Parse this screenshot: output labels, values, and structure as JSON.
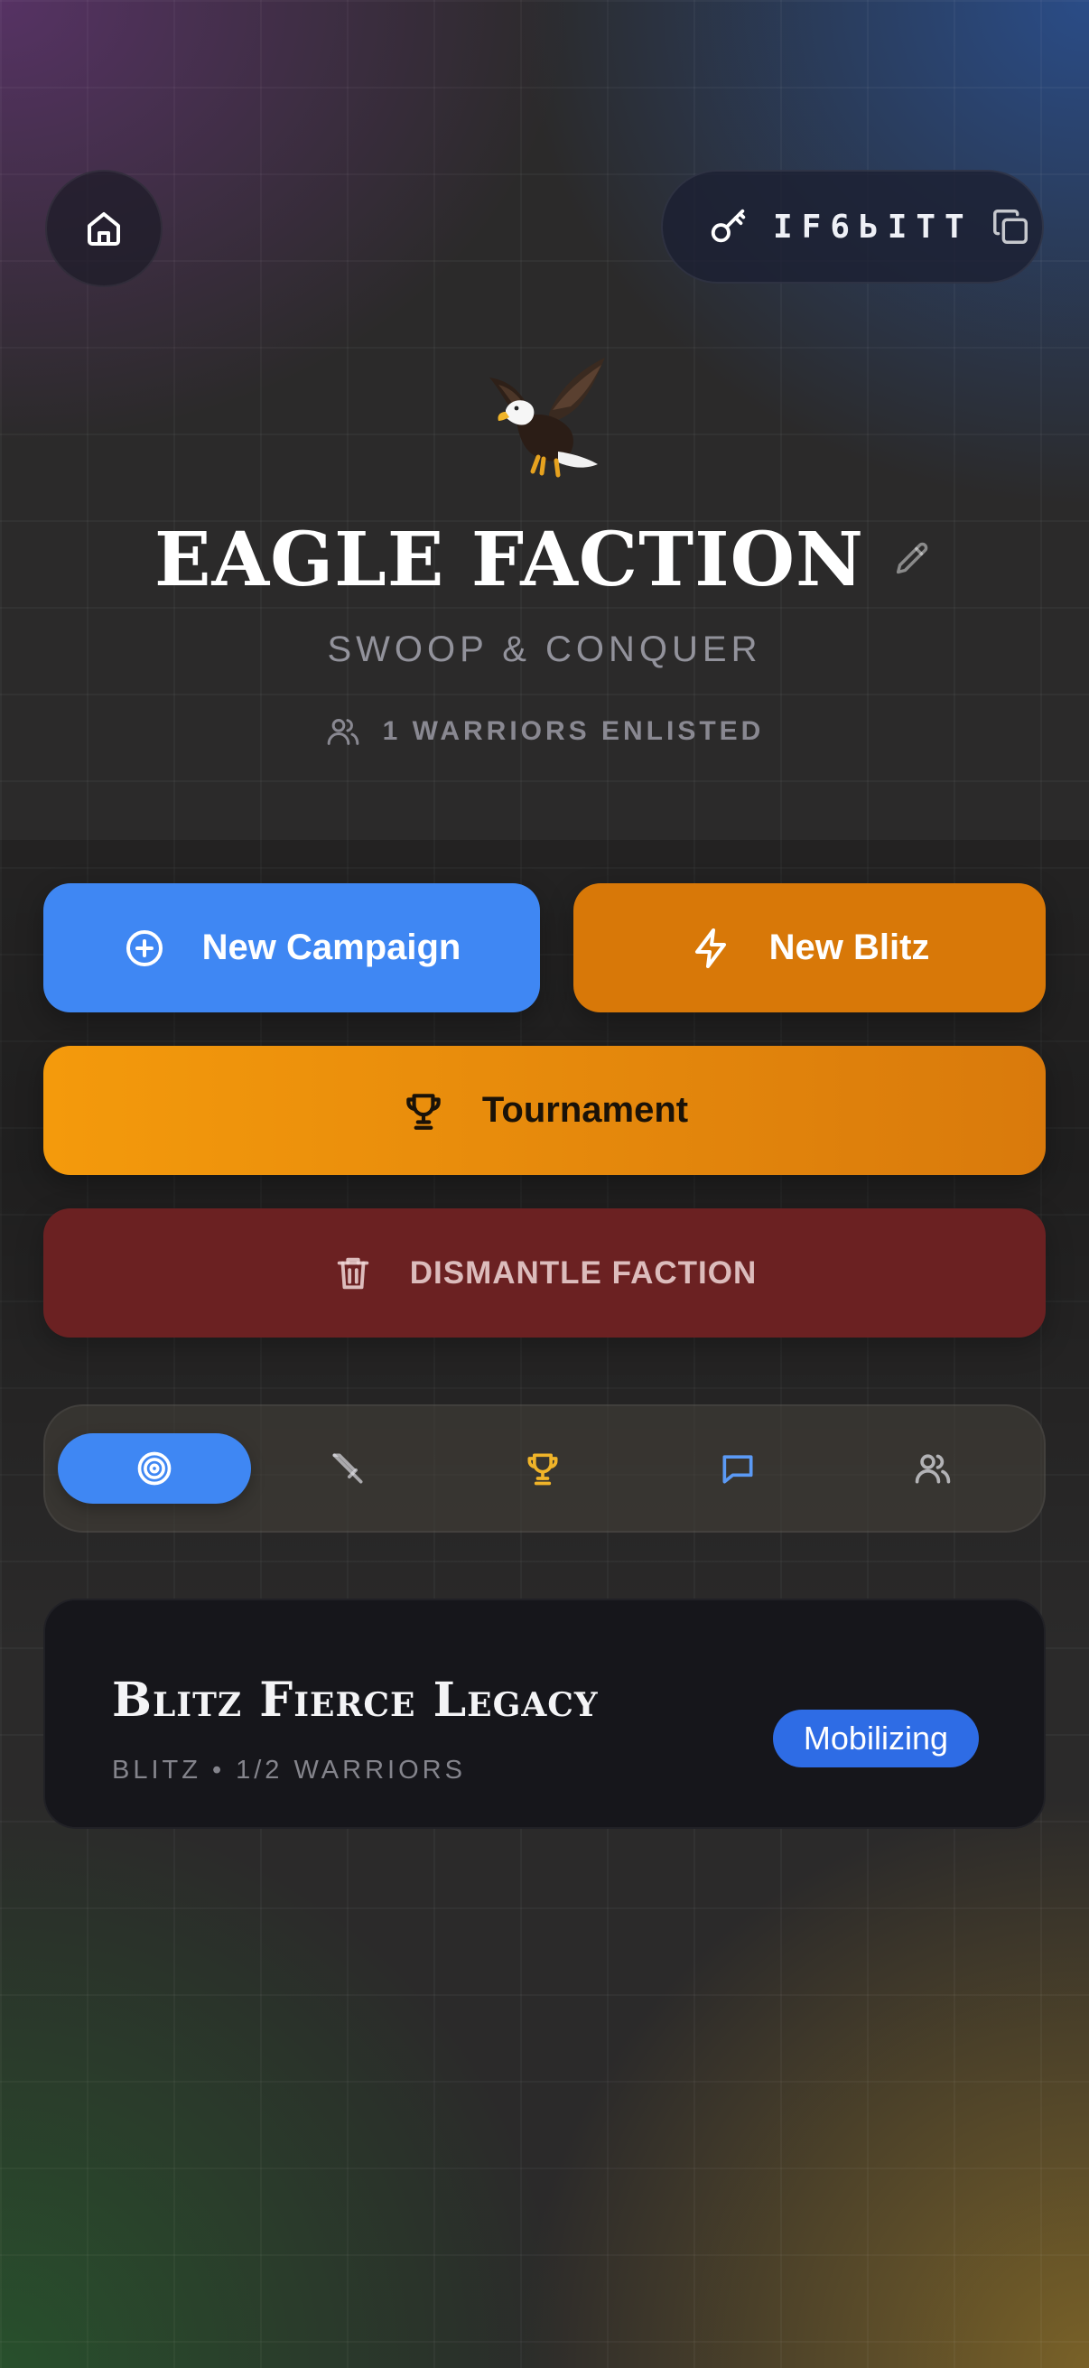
{
  "header": {
    "room_code": "IF6ЬITT"
  },
  "hero": {
    "emblem": "🦅",
    "title": "EAGLE FACTION",
    "subtitle": "SWOOP & CONQUER",
    "members_label": "1 WARRIORS ENLISTED"
  },
  "actions": {
    "new_campaign": "New Campaign",
    "new_blitz": "New Blitz",
    "tournament": "Tournament",
    "dismantle": "DISMANTLE FACTION"
  },
  "tabs": {
    "items": [
      "target-icon",
      "sword-icon",
      "trophy-icon",
      "chat-icon",
      "users-icon"
    ],
    "active_index": 0
  },
  "game_card": {
    "title": "Blitz Fierce Legacy",
    "mode": "BLITZ",
    "separator": "•",
    "players": "1/2 WARRIORS",
    "status": "Mobilizing"
  },
  "colors": {
    "primary_blue": "#3f87f3",
    "blitz_orange": "#d87808",
    "tournament_amber": "#f49a0c",
    "danger_red": "#6b2122",
    "trophy_gold": "#f0b429",
    "badge_blue": "#2e6ce5"
  }
}
